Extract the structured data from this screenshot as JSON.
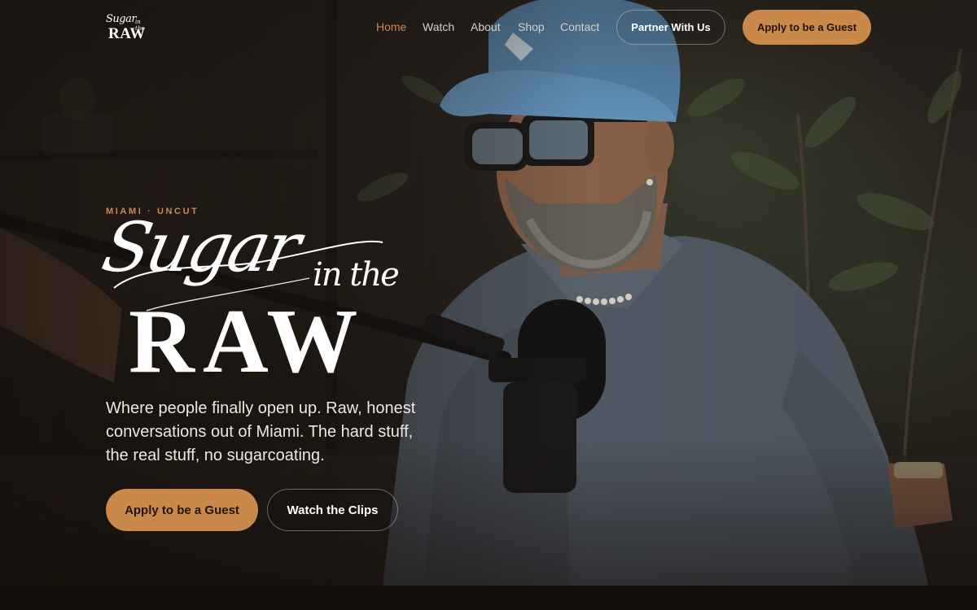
{
  "brand": {
    "logo_line1": "Sugar",
    "logo_line2": "in the",
    "logo_line3": "RAW",
    "accent_color": "#c9894a"
  },
  "nav": {
    "links": [
      {
        "label": "Home",
        "active": true
      },
      {
        "label": "Watch",
        "active": false
      },
      {
        "label": "About",
        "active": false
      },
      {
        "label": "Shop",
        "active": false
      },
      {
        "label": "Contact",
        "active": false
      }
    ],
    "partner_label": "Partner With Us",
    "apply_label": "Apply to be a Guest"
  },
  "hero": {
    "eyebrow": "MIAMI · UNCUT",
    "title_script": "Sugar",
    "title_small": "in the",
    "title_main": "RAW",
    "description": "Where people finally open up. Raw, honest conversations out of Miami. The hard stuff, the real stuff, no sugarcoating.",
    "primary_cta": "Apply to be a Guest",
    "secondary_cta": "Watch the Clips"
  }
}
